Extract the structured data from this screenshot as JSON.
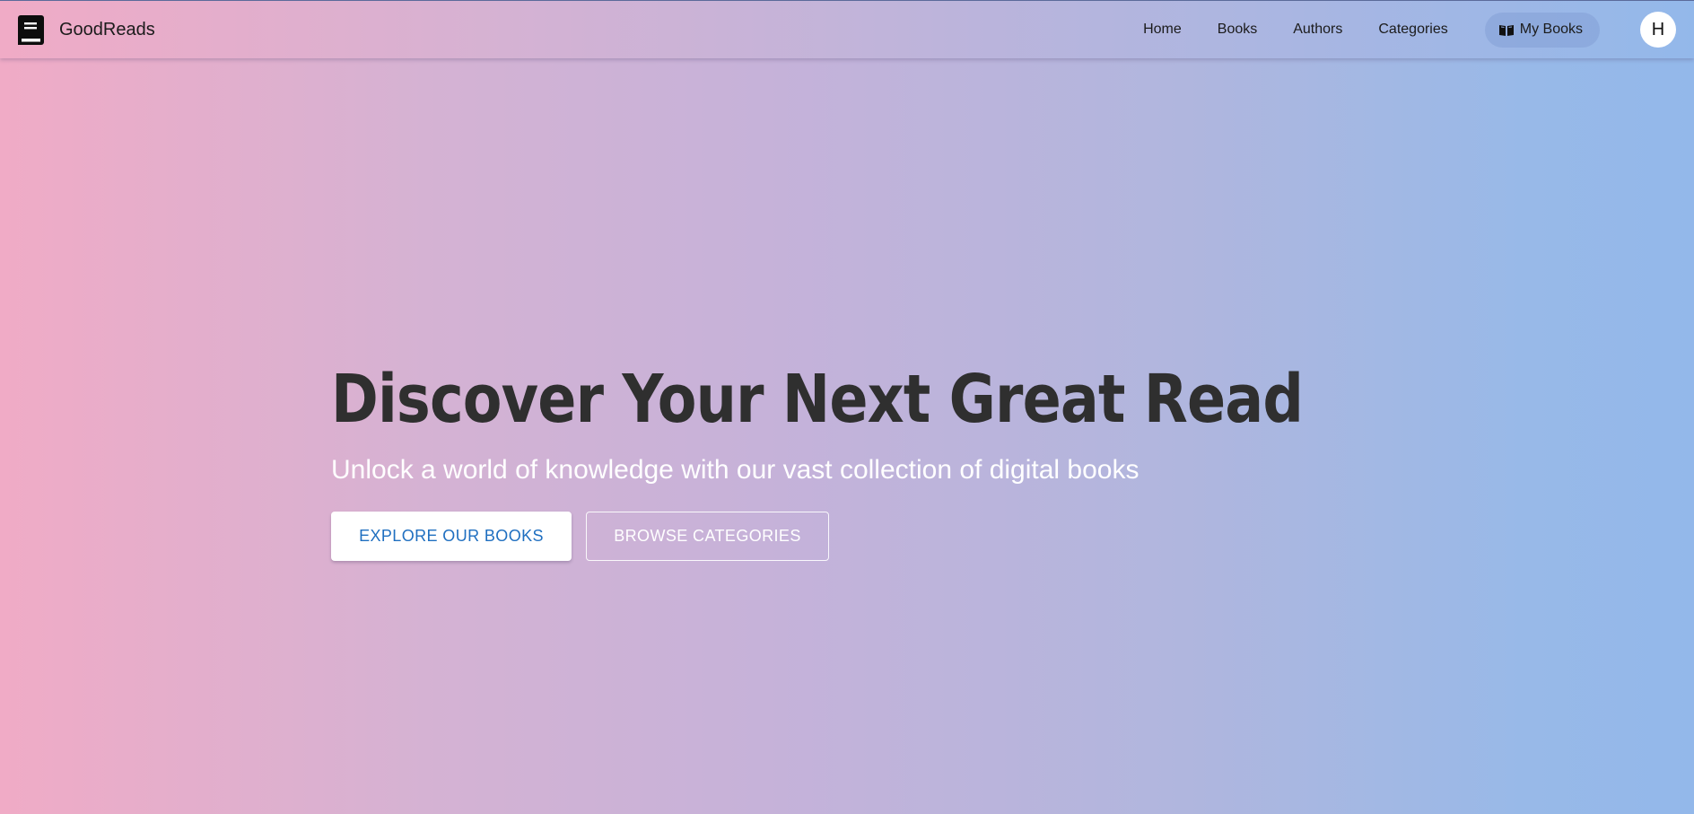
{
  "app": {
    "brand_name": "GoodReads",
    "brand_icon": "book-icon"
  },
  "nav": {
    "items": [
      {
        "label": "Home"
      },
      {
        "label": "Books"
      },
      {
        "label": "Authors"
      },
      {
        "label": "Categories"
      }
    ],
    "active": {
      "label": "My Books",
      "icon": "open-book-icon"
    },
    "avatar_initial": "H"
  },
  "hero": {
    "title": "Discover Your Next Great Read",
    "subtitle": "Unlock a world of knowledge with our vast collection of digital books",
    "primary_button": "EXPLORE OUR BOOKS",
    "secondary_button": "BROWSE CATEGORIES"
  },
  "colors": {
    "gradient_start": "#f0abc6",
    "gradient_end": "#93b8ea",
    "primary_button_text": "#1f6fc0",
    "title_text": "#2f2f2f"
  }
}
